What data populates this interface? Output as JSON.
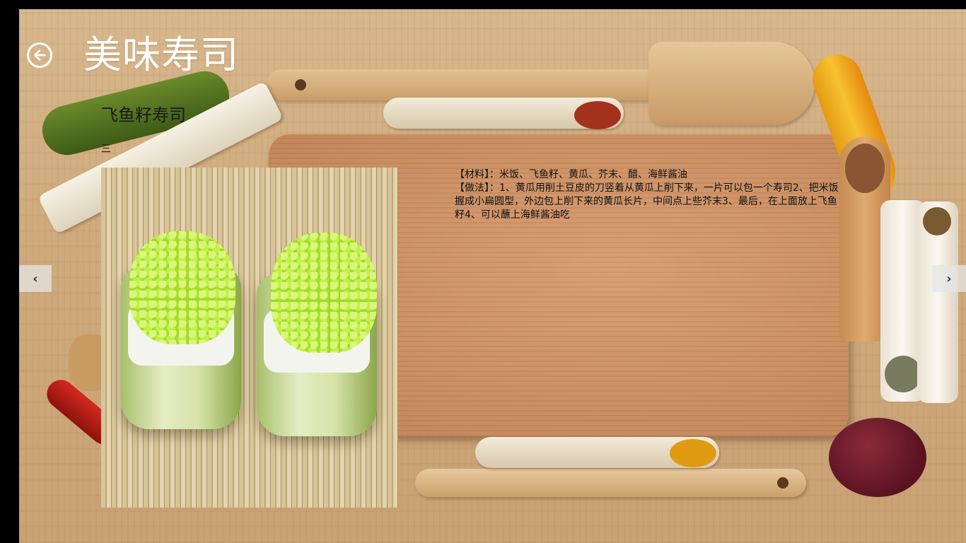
{
  "header": {
    "back_icon": "back-arrow-icon",
    "title": "美味寿司"
  },
  "recipe": {
    "name": "飞鱼籽寿司",
    "subtitle": "三",
    "ingredients": "【材料】：米饭、飞鱼籽、黄瓜、芥末、醋、海鲜酱油",
    "method": "【做法】：1、黄瓜用削土豆皮的刀竖着从黄瓜上削下来，一片可以包一个寿司2、把米饭握成小扁圆型，外边包上削下来的黄瓜长片，中间点上些芥末3、最后，在上面放上飞鱼籽4、可以蘸上海鲜酱油吃"
  },
  "nav": {
    "prev_label": "‹",
    "next_label": "›"
  },
  "colors": {
    "title": "#ffffff",
    "text": "#111111",
    "wood": "#cfab7d"
  }
}
